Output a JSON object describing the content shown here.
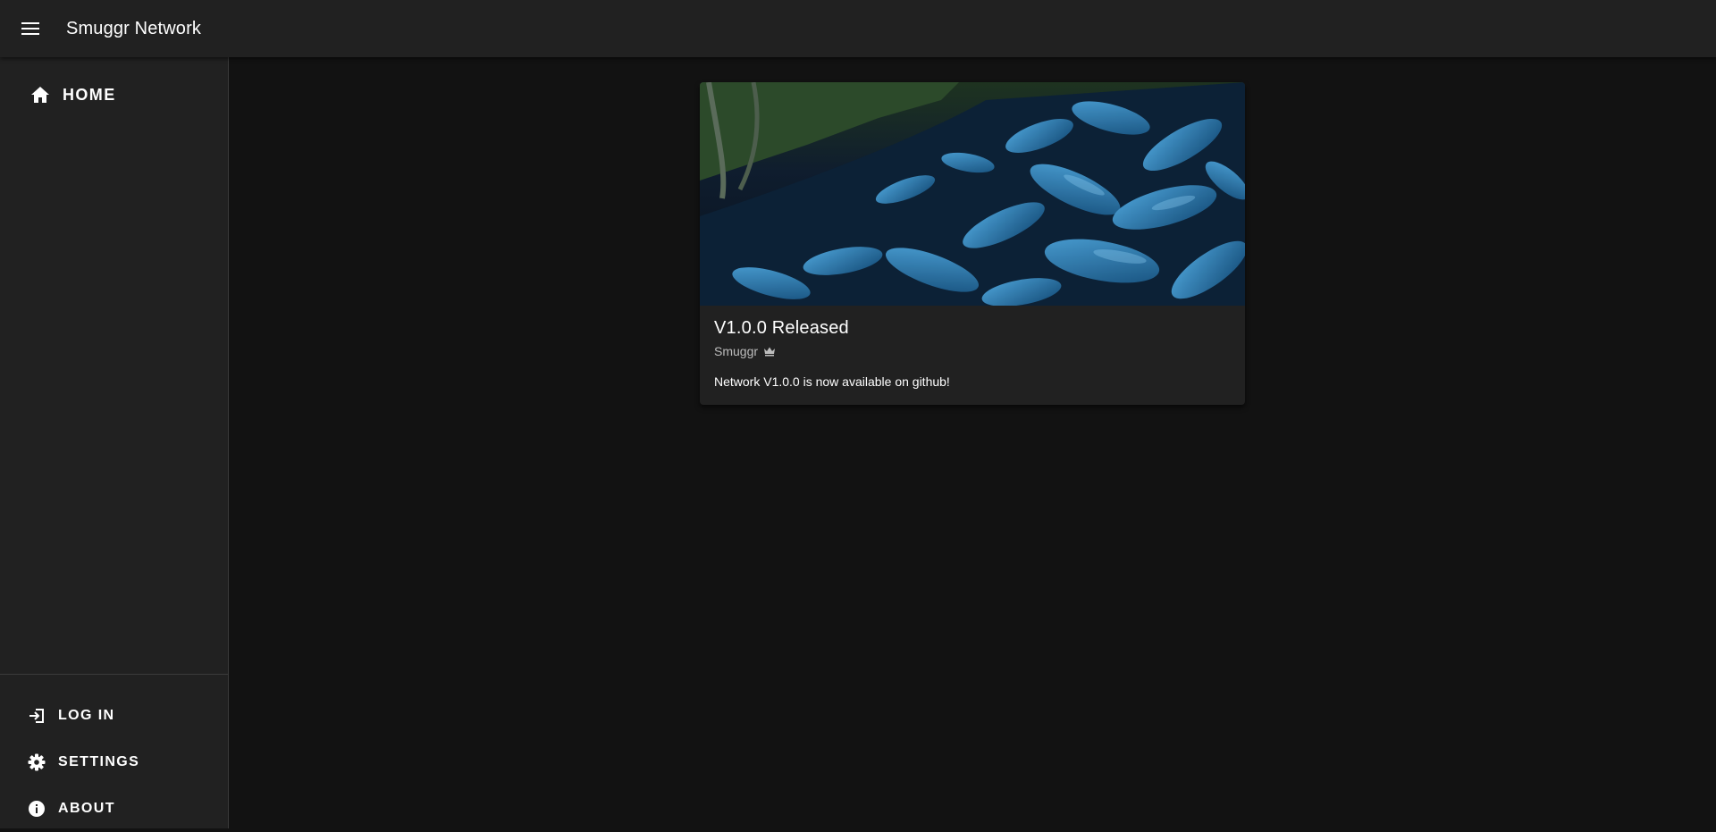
{
  "app": {
    "title": "Smuggr Network",
    "menu_icon": "menu-icon"
  },
  "drawer": {
    "home": {
      "label": "HOME",
      "icon": "home-icon"
    },
    "bottom_items": [
      {
        "label": "LOG IN",
        "icon": "login-icon"
      },
      {
        "label": "SETTINGS",
        "icon": "gear-icon"
      },
      {
        "label": "ABOUT",
        "icon": "info-icon"
      }
    ]
  },
  "post": {
    "image": "blue-leaves-forest-image",
    "title": "V1.0.0 Released",
    "author": "Smuggr",
    "author_badge_icon": "crown-icon",
    "body": "Network V1.0.0 is now available on github!"
  },
  "colors": {
    "background": "#121212",
    "surface": "#212121",
    "text": "#ffffff",
    "subtitle": "#bdbdbd"
  }
}
